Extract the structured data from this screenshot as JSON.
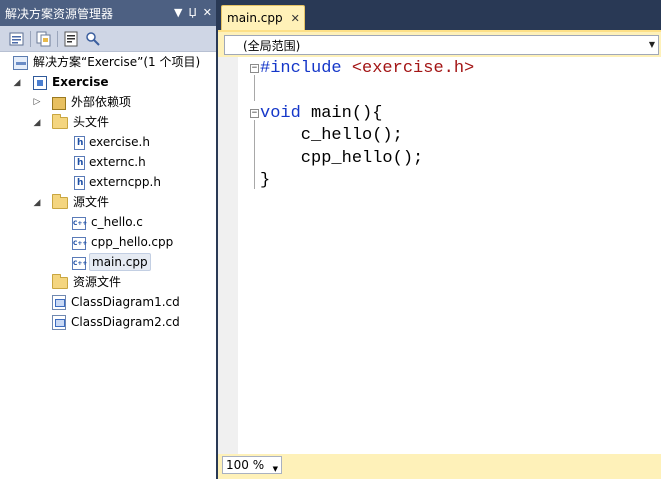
{
  "solution_explorer": {
    "title": "解决方案资源管理器",
    "title_buttons": [
      "▼",
      "Џ",
      "✕"
    ],
    "tree": {
      "solution": "解决方案“Exercise”(1 个项目)",
      "project": "Exercise",
      "external_deps": "外部依赖项",
      "headers_folder": "头文件",
      "headers": [
        "exercise.h",
        "externc.h",
        "externcpp.h"
      ],
      "sources_folder": "源文件",
      "sources": [
        "c_hello.c",
        "cpp_hello.cpp",
        "main.cpp"
      ],
      "resources_folder": "资源文件",
      "diagrams": [
        "ClassDiagram1.cd",
        "ClassDiagram2.cd"
      ]
    }
  },
  "editor": {
    "tab_label": "main.cpp",
    "tab_close": "✕",
    "scope": "(全局范围)",
    "code": {
      "l1_kw": "#include",
      "l1_inc": " <exercise.h>",
      "l3_kw": "void",
      "l3_rest": " main(){",
      "l4": "    c_hello();",
      "l5": "    cpp_hello();",
      "l6": "}"
    },
    "zoom": "100 %"
  },
  "colors": {
    "chrome": "#293955",
    "tab_active": "#fff1b8",
    "keyword": "#1537c9",
    "include_string": "#a31515"
  }
}
